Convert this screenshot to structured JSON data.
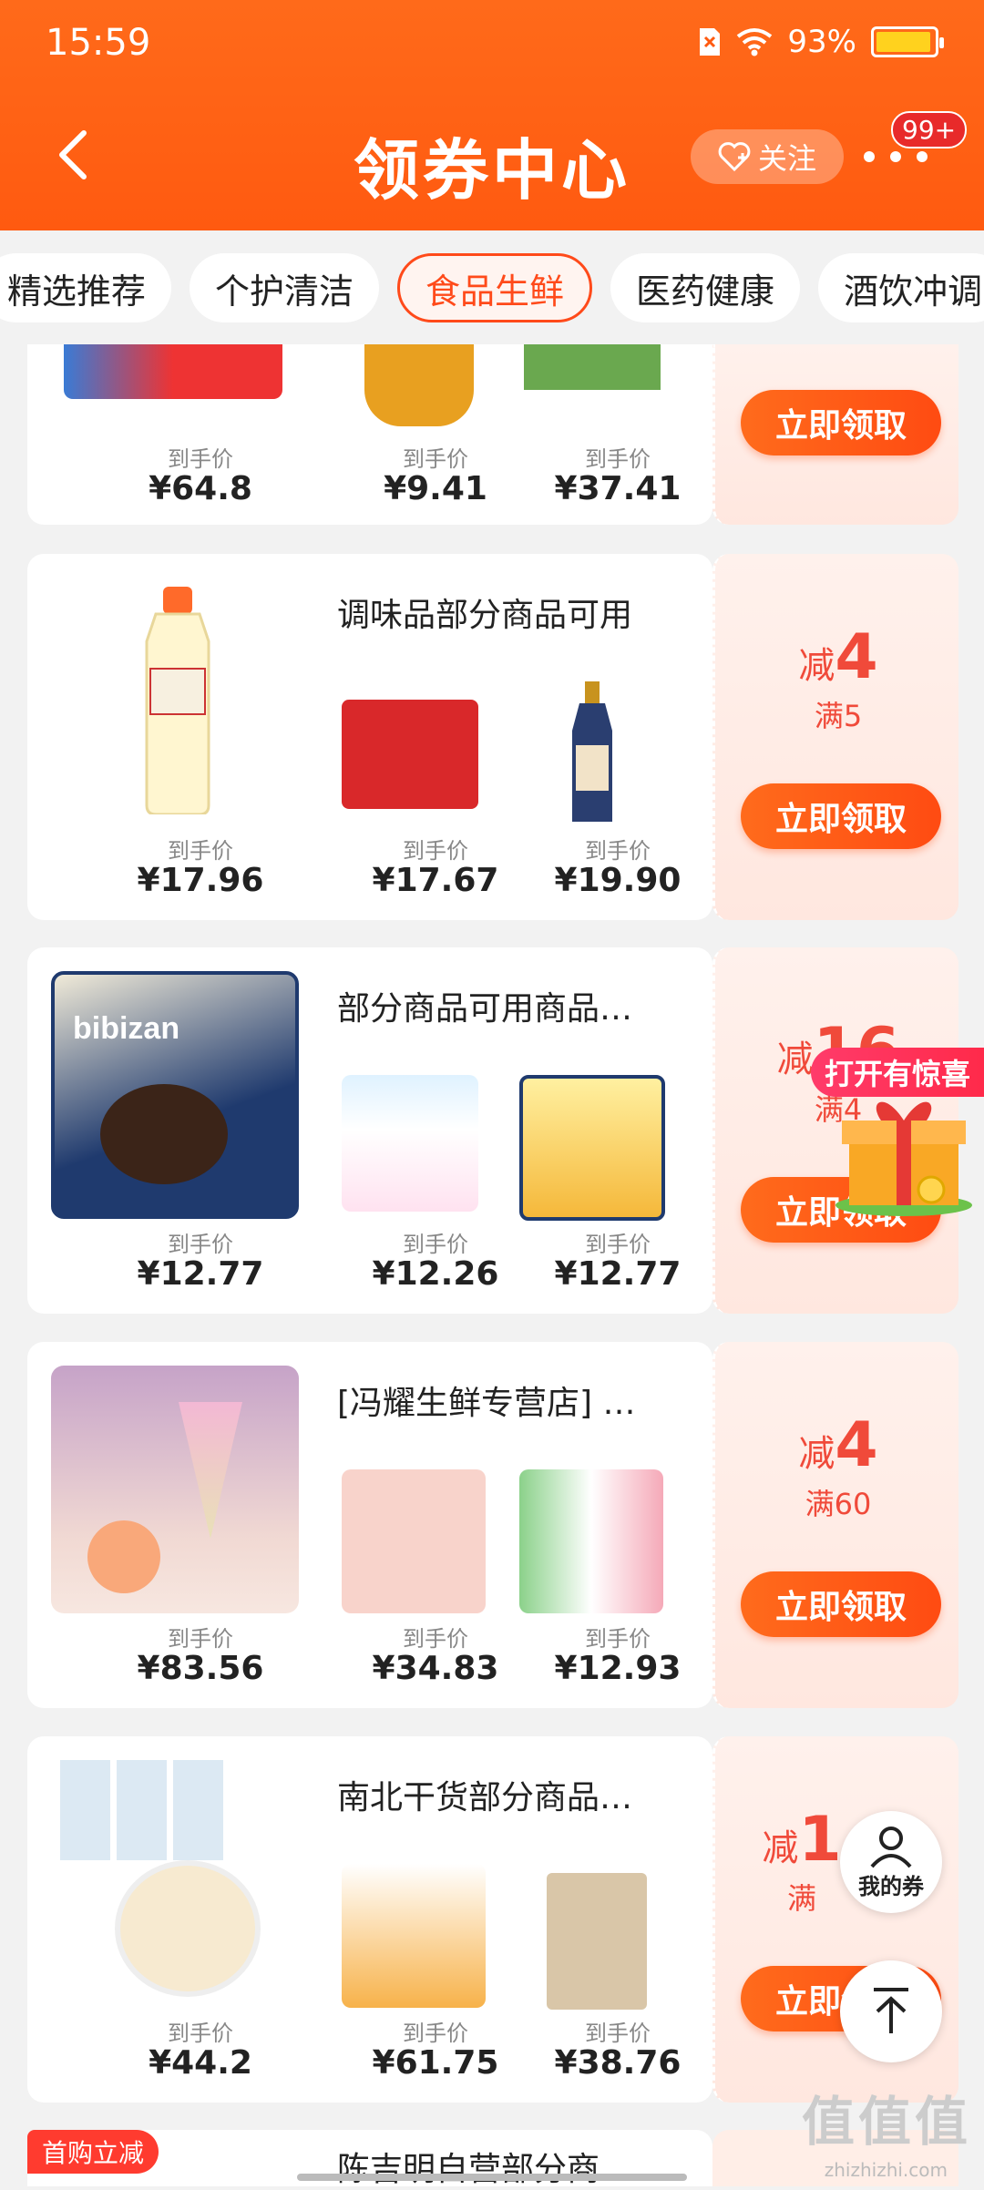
{
  "status": {
    "time": "15:59",
    "battery": "93%"
  },
  "header": {
    "title": "领券中心",
    "follow_label": "关注",
    "badge": "99+"
  },
  "tabs": [
    {
      "label": "精选推荐"
    },
    {
      "label": "个护清洁"
    },
    {
      "label": "食品生鲜"
    },
    {
      "label": "医药健康"
    },
    {
      "label": "酒饮冲调"
    }
  ],
  "active_tab": "食品生鲜",
  "price_label": "到手价",
  "claim_label": "立即领取",
  "cards": [
    {
      "title": "",
      "deal_prefix": "",
      "deal_amount": "",
      "deal_min": "",
      "prices": [
        "¥64.8",
        "¥9.41",
        "¥37.41"
      ]
    },
    {
      "title": "调味品部分商品可用",
      "deal_prefix": "减",
      "deal_amount": "4",
      "deal_min": "满5",
      "prices": [
        "¥17.96",
        "¥17.67",
        "¥19.90"
      ]
    },
    {
      "title": "部分商品可用商品…",
      "deal_prefix": "减",
      "deal_amount": "16",
      "deal_min": "满4",
      "prices": [
        "¥12.77",
        "¥12.26",
        "¥12.77"
      ]
    },
    {
      "title": "[冯耀生鲜专营店] …",
      "deal_prefix": "减",
      "deal_amount": "4",
      "deal_min": "满60",
      "prices": [
        "¥83.56",
        "¥34.83",
        "¥12.93"
      ]
    },
    {
      "title": "南北干货部分商品…",
      "deal_prefix": "减",
      "deal_amount": "1",
      "deal_min": "满",
      "prices": [
        "¥44.2",
        "¥61.75",
        "¥38.76"
      ]
    }
  ],
  "bottom_card": {
    "badge": "首购立减",
    "title": "陈吉明自营部分商"
  },
  "gift_popup": {
    "label": "打开有惊喜"
  },
  "float_buttons": {
    "my_coupons": "我的券"
  },
  "watermark": {
    "main": "值值值",
    "sub": "zhizhizhi.com"
  },
  "colors": {
    "header": "#ff5a10",
    "accent": "#ff4a1a",
    "deal": "#f04a3a"
  }
}
